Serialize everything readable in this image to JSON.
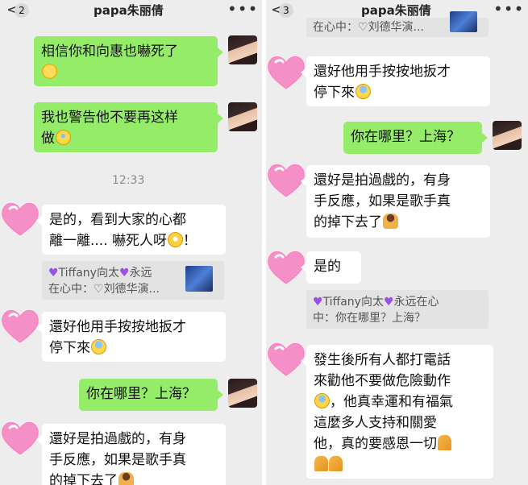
{
  "left": {
    "back": "<",
    "badge": "2",
    "title": "papa朱丽倩",
    "more": "•••",
    "messages": [
      {
        "lines": [
          "相信你和向惠也嚇死了"
        ]
      },
      {
        "lines": [
          "我也警告他不要再这样",
          "做"
        ]
      },
      {
        "lines": [
          "是的，看到大家的心都",
          "離一離.... 嚇死人呀",
          "！"
        ]
      },
      {
        "lines": [
          "還好他用手按按地扳才",
          "停下來"
        ]
      },
      {
        "lines": [
          "你在哪里？上海？"
        ]
      },
      {
        "lines": [
          "還好是拍過戲的，有身",
          "手反應，如果是歌手真",
          "的掉下去了"
        ]
      }
    ],
    "time": "12:33",
    "quote": {
      "lines": [
        "Tiffany向太",
        "永远",
        "在心中：",
        "刘德华演..."
      ]
    }
  },
  "right": {
    "back": "<",
    "badge": "3",
    "title": "papa朱丽倩",
    "more": "•••",
    "top_quote": "在心中：",
    "top_quote_tail": "刘德华演...",
    "messages": [
      {
        "lines": [
          "還好他用手按按地扳才",
          "停下來"
        ]
      },
      {
        "lines": [
          "你在哪里？上海？"
        ]
      },
      {
        "lines": [
          "還好是拍過戲的，有身",
          "手反應，如果是歌手真",
          "的掉下去了"
        ]
      },
      {
        "lines": [
          "是的"
        ]
      },
      {
        "lines": [
          "發生後所有人都打電話",
          "來勸他不要做危險動作",
          "，他真幸運和有福氣",
          "這麼多人支持和關愛",
          "他，真的要感恩一切",
          ""
        ]
      }
    ],
    "quote": {
      "lines": [
        "Tiffany向太",
        "永远在心",
        "中：你在哪里？上海？"
      ]
    }
  },
  "colors": {
    "green_bubble": "#95ec69",
    "white_bubble": "#ffffff",
    "background": "#ededed"
  },
  "icons": [
    "back-arrow-icon",
    "more-dots-icon",
    "heart-avatar-icon",
    "scared-face-emoji",
    "praying-hands-emoji",
    "purple-heart-emoji"
  ]
}
